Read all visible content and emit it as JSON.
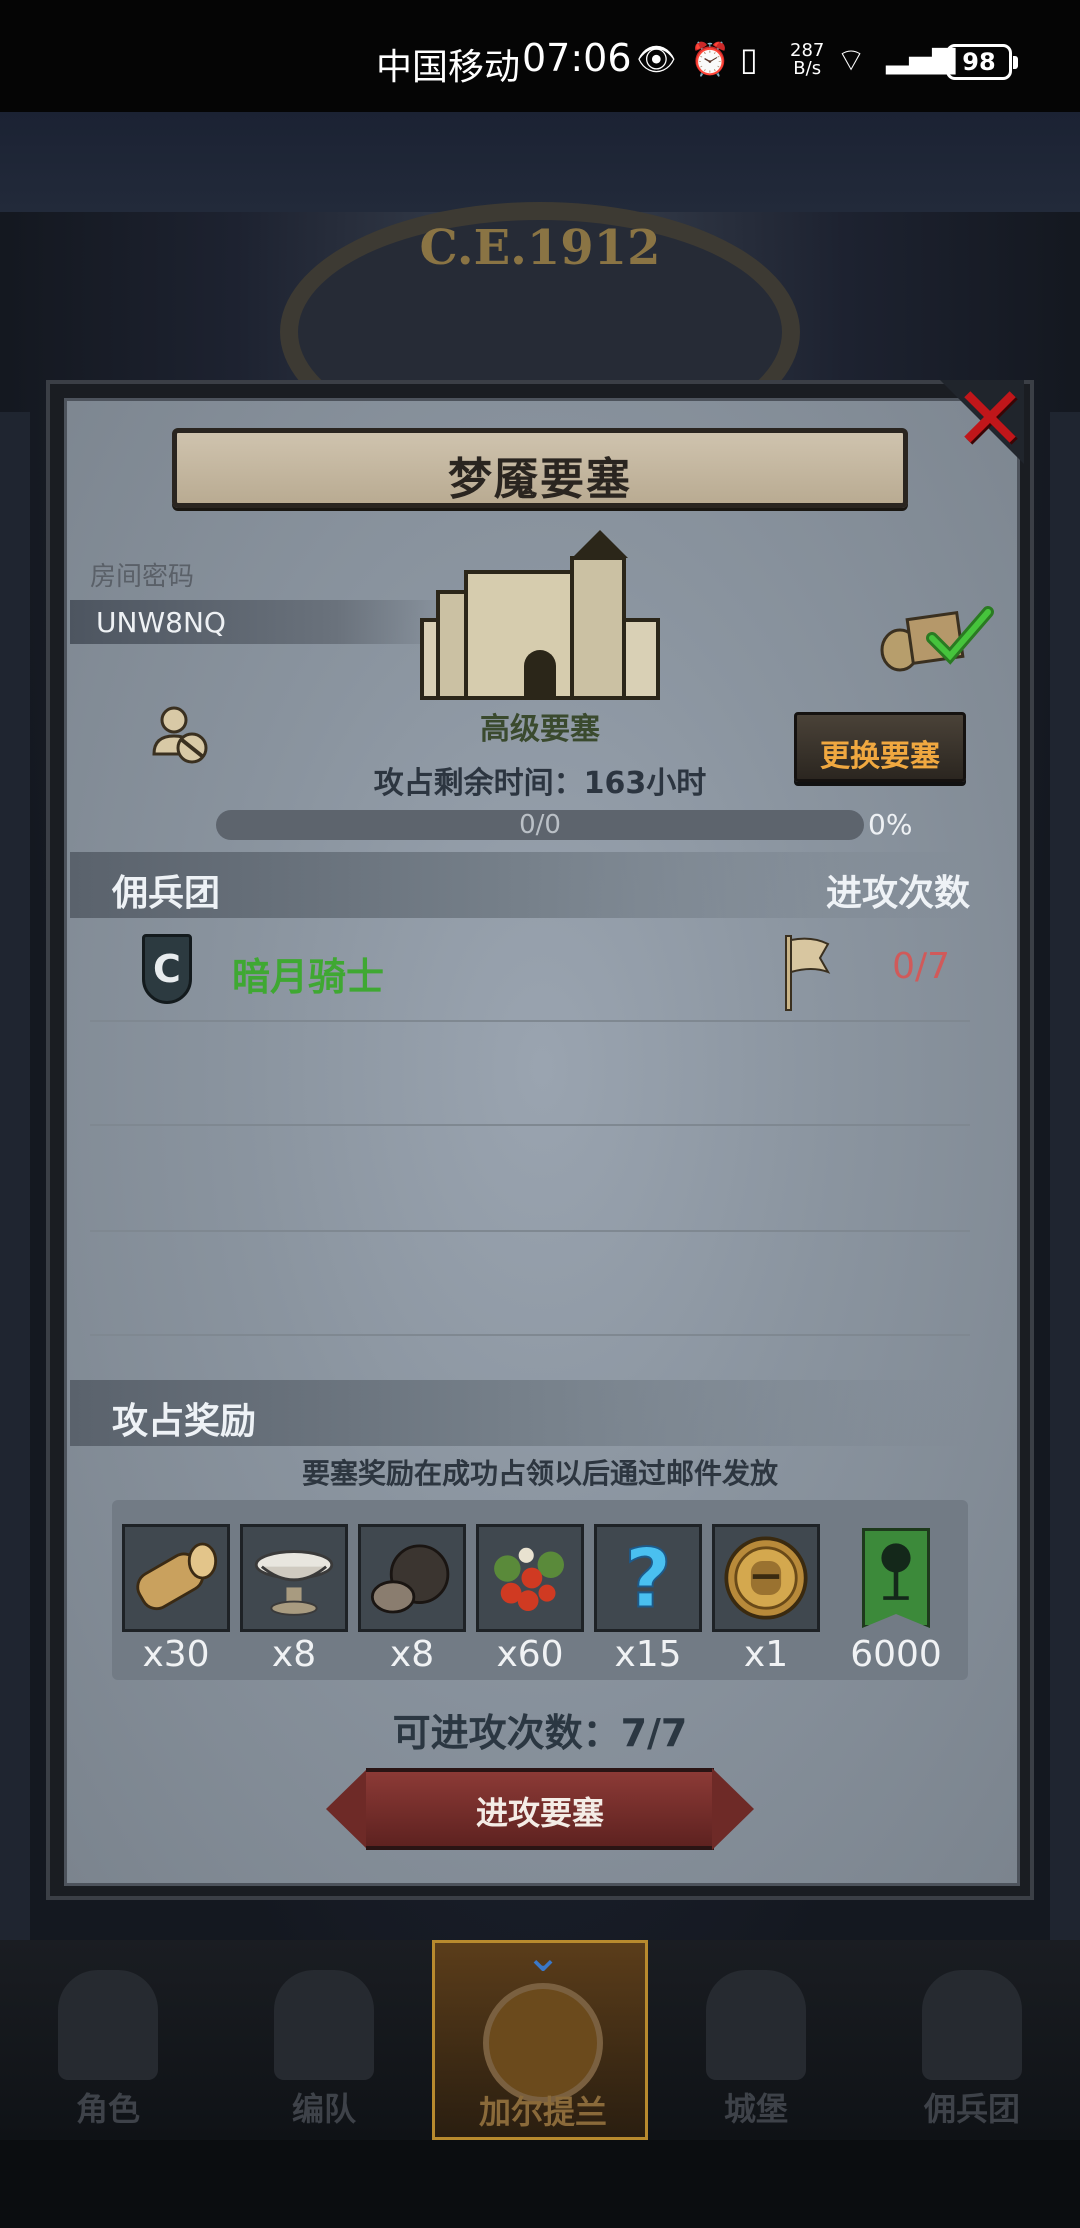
{
  "status_bar": {
    "carrier": "中国移动",
    "time": "07:06",
    "speed_value": "287",
    "speed_unit": "B/s",
    "battery": "98"
  },
  "scene": {
    "year_label": "C.E.1912"
  },
  "dialog": {
    "title": "梦魇要塞",
    "room_code_label": "房间密码",
    "room_code": "UNW8NQ",
    "fortress_grade": "高级要塞",
    "change_button": "更换要塞",
    "remaining_time": "攻占剩余时间：163小时",
    "progress": {
      "text": "0/0",
      "percent_text": "0%",
      "fraction": 0
    },
    "mercenary_header": "佣兵团",
    "attack_times_header": "进攻次数",
    "mercenaries": [
      {
        "emblem_letter": "C",
        "name": "暗月骑士",
        "attacks": "0/7"
      }
    ],
    "rewards_header": "攻占奖励",
    "rewards_note": "要塞奖励在成功占领以后通过邮件发放",
    "rewards": [
      {
        "icon": "wood-log-icon",
        "qty": "x30"
      },
      {
        "icon": "silver-bowl-icon",
        "qty": "x8"
      },
      {
        "icon": "truffle-icon",
        "qty": "x8"
      },
      {
        "icon": "berries-icon",
        "qty": "x60"
      },
      {
        "icon": "mystery-question-icon",
        "qty": "x15"
      },
      {
        "icon": "knight-coin-icon",
        "qty": "x1"
      },
      {
        "icon": "guild-banner-icon",
        "qty": "6000"
      }
    ],
    "attack_count": "可进攻次数：7/7",
    "attack_button": "进攻要塞"
  },
  "bottom_nav": [
    {
      "label": "角色",
      "icon": "knight-icon",
      "active": false
    },
    {
      "label": "编队",
      "icon": "helmet-icon",
      "active": false
    },
    {
      "label": "加尔提兰",
      "icon": "globe-icon",
      "active": true
    },
    {
      "label": "城堡",
      "icon": "castle-icon",
      "active": false
    },
    {
      "label": "佣兵团",
      "icon": "banner-icon",
      "active": false
    }
  ],
  "colors": {
    "accent_orange": "#f0a840",
    "guild_green": "#3fa832",
    "attack_red": "#d05a5a",
    "close_red": "#c0161a"
  }
}
